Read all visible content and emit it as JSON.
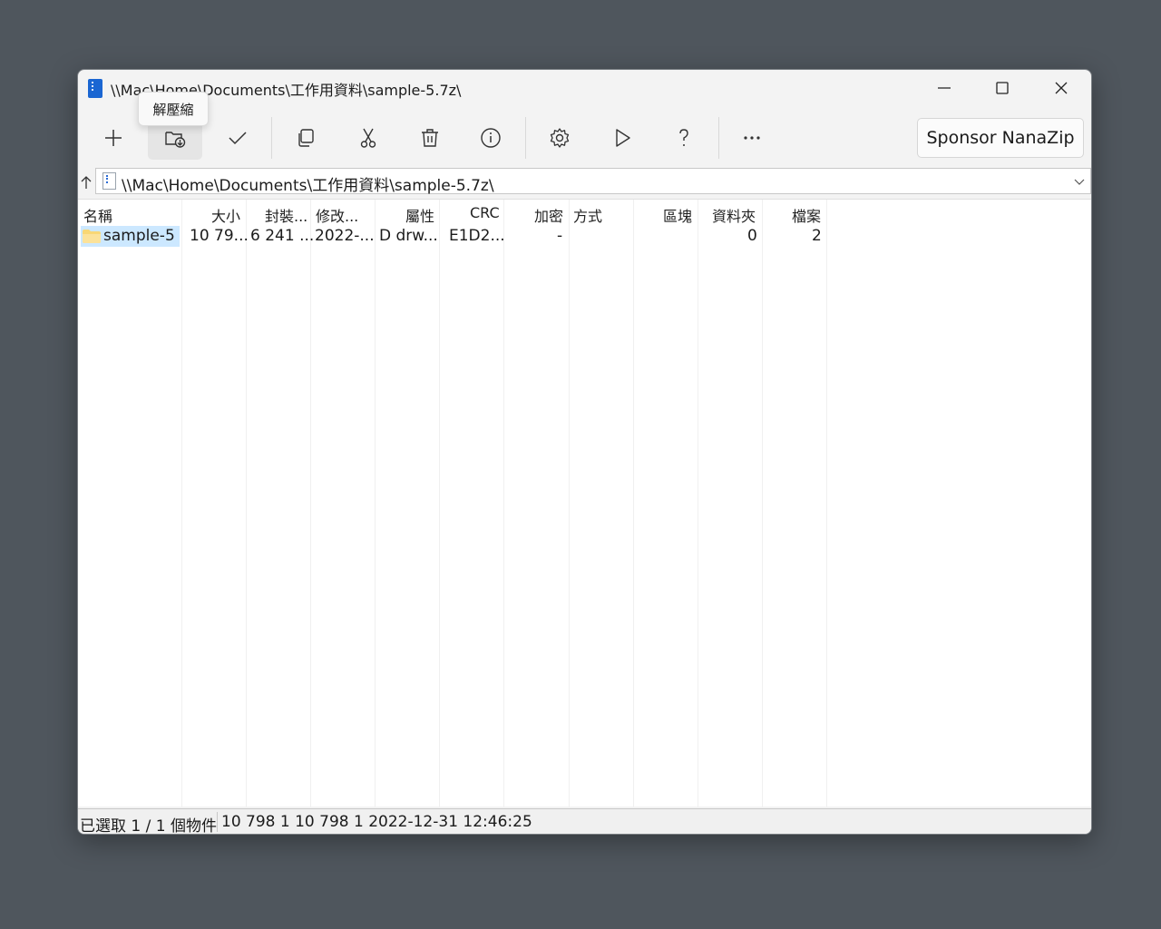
{
  "window": {
    "title": "\\\\Mac\\Home\\Documents\\工作用資料\\sample-5.7z\\",
    "controls": {
      "minimize": "minimize-icon",
      "maximize": "maximize-icon",
      "close": "close-icon"
    }
  },
  "tooltip": {
    "text": "解壓縮"
  },
  "toolbar": {
    "buttons": [
      {
        "id": "add",
        "icon": "plus-icon"
      },
      {
        "id": "extract",
        "icon": "folder-extract-icon",
        "active": true
      },
      {
        "id": "test",
        "icon": "checkmark-icon"
      },
      {
        "id": "copy",
        "icon": "copy-icon"
      },
      {
        "id": "move",
        "icon": "scissors-icon"
      },
      {
        "id": "delete",
        "icon": "trash-icon"
      },
      {
        "id": "info",
        "icon": "info-icon"
      },
      {
        "id": "options",
        "icon": "gear-icon"
      },
      {
        "id": "benchmark",
        "icon": "play-icon"
      },
      {
        "id": "help",
        "icon": "help-icon"
      },
      {
        "id": "more",
        "icon": "more-icon"
      }
    ],
    "sponsor_label": "Sponsor NanaZip"
  },
  "address": {
    "path": "\\\\Mac\\Home\\Documents\\工作用資料\\sample-5.7z\\"
  },
  "list": {
    "columns": [
      "名稱",
      "大小",
      "封裝...",
      "修改...",
      "屬性",
      "CRC",
      "加密",
      "方式",
      "區塊",
      "資料夾",
      "檔案"
    ],
    "rows": [
      {
        "name": "sample-5",
        "size": "10 79...",
        "packed": "6 241 ...",
        "modified": "2022-...",
        "attributes": "D drw...",
        "crc": "E1D2...",
        "encrypted": "-",
        "method": "",
        "block": "",
        "folders": "0",
        "files": "2"
      }
    ]
  },
  "status": {
    "selection": "已選取 1 / 1 個物件",
    "details": "10 798 1 10 798 1 2022-12-31 12:46:25"
  }
}
